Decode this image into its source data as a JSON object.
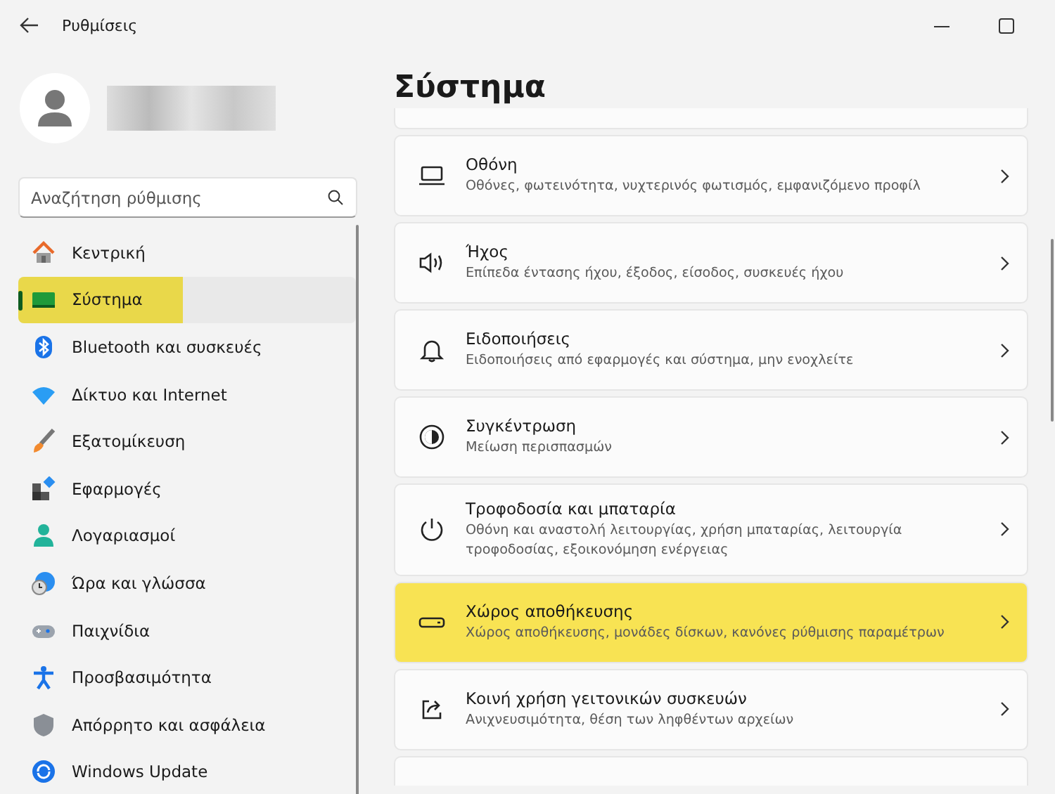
{
  "window": {
    "title": "Ρυθμίσεις"
  },
  "search": {
    "placeholder": "Αναζήτηση ρύθμισης"
  },
  "sidebar": {
    "items": [
      {
        "label": "Κεντρική",
        "kind": "home",
        "selected": false,
        "highlighted": false
      },
      {
        "label": "Σύστημα",
        "kind": "system",
        "selected": true,
        "highlighted": true
      },
      {
        "label": "Bluetooth και συσκευές",
        "kind": "bluetooth",
        "selected": false,
        "highlighted": false
      },
      {
        "label": "Δίκτυο και Internet",
        "kind": "wifi",
        "selected": false,
        "highlighted": false
      },
      {
        "label": "Εξατομίκευση",
        "kind": "brush",
        "selected": false,
        "highlighted": false
      },
      {
        "label": "Εφαρμογές",
        "kind": "apps",
        "selected": false,
        "highlighted": false
      },
      {
        "label": "Λογαριασμοί",
        "kind": "person",
        "selected": false,
        "highlighted": false
      },
      {
        "label": "Ώρα και γλώσσα",
        "kind": "clock",
        "selected": false,
        "highlighted": false
      },
      {
        "label": "Παιχνίδια",
        "kind": "gamepad",
        "selected": false,
        "highlighted": false
      },
      {
        "label": "Προσβασιμότητα",
        "kind": "access",
        "selected": false,
        "highlighted": false
      },
      {
        "label": "Απόρρητο και ασφάλεια",
        "kind": "shield",
        "selected": false,
        "highlighted": false
      },
      {
        "label": "Windows Update",
        "kind": "update",
        "selected": false,
        "highlighted": false
      }
    ]
  },
  "page": {
    "title": "Σύστημα",
    "cards": [
      {
        "kind": "display",
        "title": "Οθόνη",
        "subtitle": "Οθόνες, φωτεινότητα, νυχτερινός φωτισμός, εμφανιζόμενο προφίλ",
        "highlighted": false
      },
      {
        "kind": "sound",
        "title": "Ήχος",
        "subtitle": "Επίπεδα έντασης ήχου, έξοδος, είσοδος, συσκευές ήχου",
        "highlighted": false
      },
      {
        "kind": "bell",
        "title": "Ειδοποιήσεις",
        "subtitle": "Ειδοποιήσεις από εφαρμογές και σύστημα, μην ενοχλείτε",
        "highlighted": false
      },
      {
        "kind": "focus",
        "title": "Συγκέντρωση",
        "subtitle": "Μείωση περισπασμών",
        "highlighted": false
      },
      {
        "kind": "power",
        "title": "Τροφοδοσία και μπαταρία",
        "subtitle": "Οθόνη και αναστολή λειτουργίας, χρήση μπαταρίας, λειτουργία τροφοδοσίας, εξοικονόμηση ενέργειας",
        "highlighted": false
      },
      {
        "kind": "storage",
        "title": "Χώρος αποθήκευσης",
        "subtitle": "Χώρος αποθήκευσης, μονάδες δίσκων, κανόνες ρύθμισης παραμέτρων",
        "highlighted": true
      },
      {
        "kind": "share",
        "title": "Κοινή χρήση γειτονικών συσκευών",
        "subtitle": "Ανιχνευσιμότητα, θέση των ληφθέντων αρχείων",
        "highlighted": false
      }
    ]
  }
}
